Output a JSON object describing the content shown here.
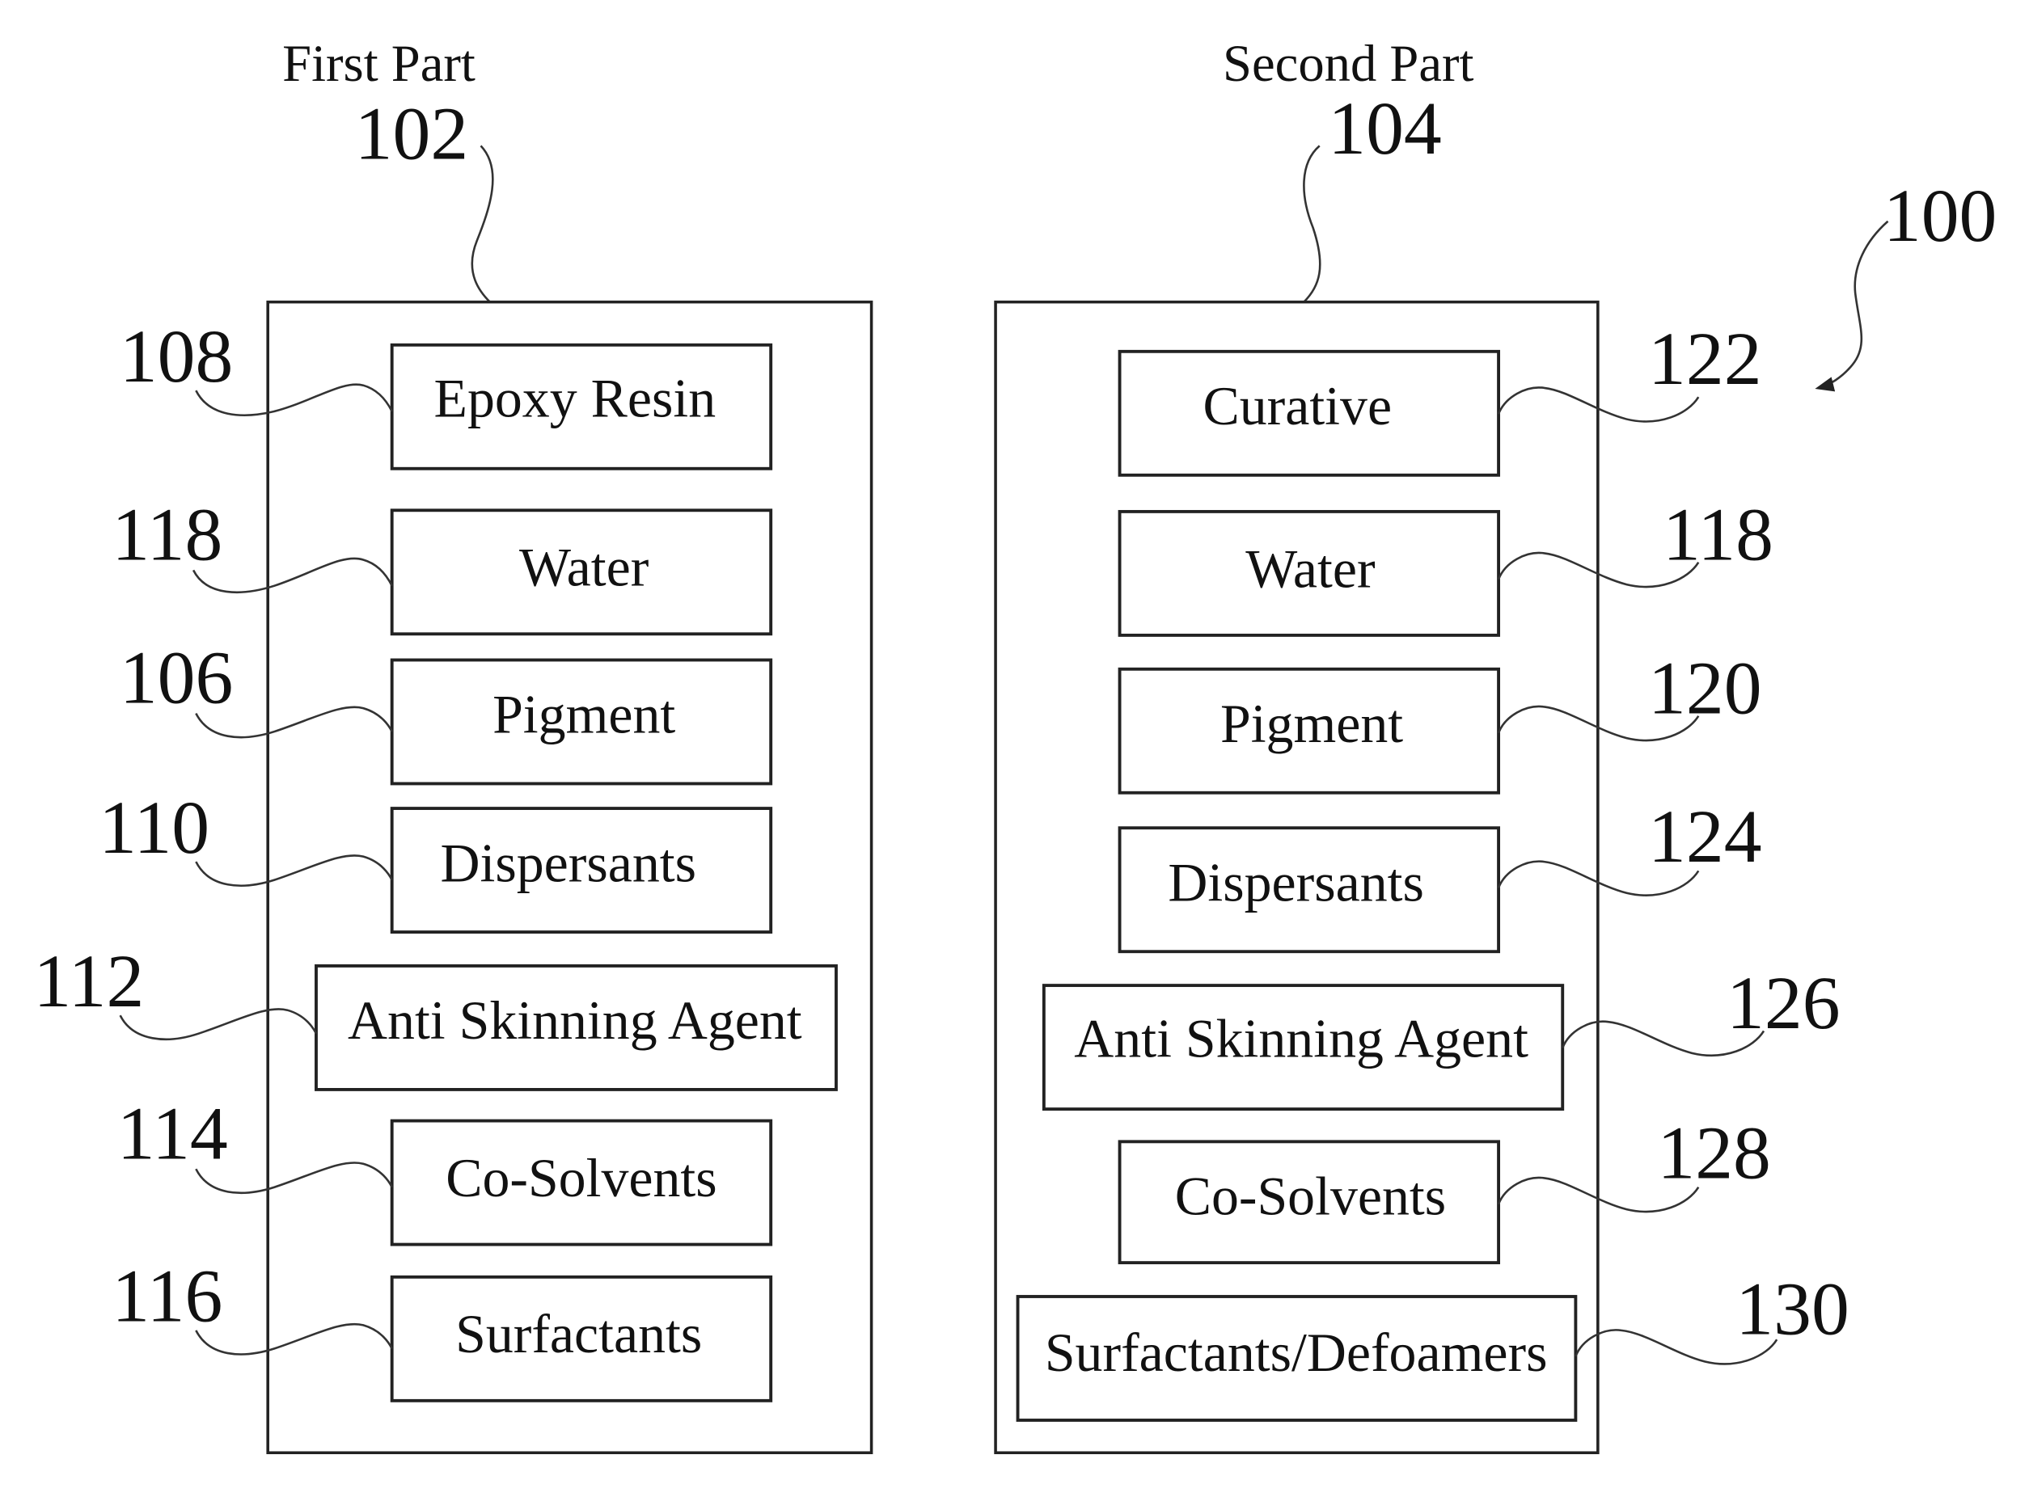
{
  "figure_ref": "100",
  "parts": [
    {
      "title": "First Part",
      "ref": "102",
      "items": [
        {
          "label": "Epoxy Resin",
          "ref": "108"
        },
        {
          "label": "Water",
          "ref": "118"
        },
        {
          "label": "Pigment",
          "ref": "106"
        },
        {
          "label": "Dispersants",
          "ref": "110"
        },
        {
          "label": "Anti Skinning Agent",
          "ref": "112"
        },
        {
          "label": "Co-Solvents",
          "ref": "114"
        },
        {
          "label": "Surfactants",
          "ref": "116"
        }
      ]
    },
    {
      "title": "Second Part",
      "ref": "104",
      "items": [
        {
          "label": "Curative",
          "ref": "122"
        },
        {
          "label": "Water",
          "ref": "118"
        },
        {
          "label": "Pigment",
          "ref": "120"
        },
        {
          "label": "Dispersants",
          "ref": "124"
        },
        {
          "label": "Anti Skinning Agent",
          "ref": "126"
        },
        {
          "label": "Co-Solvents",
          "ref": "128"
        },
        {
          "label": "Surfactants/Defoamers",
          "ref": "130"
        }
      ]
    }
  ]
}
